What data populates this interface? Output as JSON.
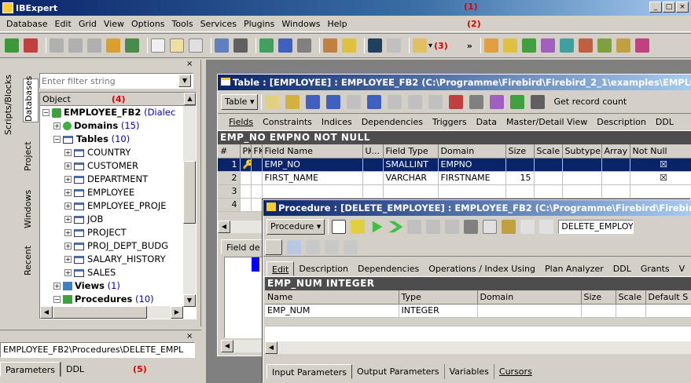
{
  "app": {
    "title": "IBExpert",
    "annotation1": "(1)",
    "annotation2": "(2)",
    "annotation3": "(3)",
    "annotation4": "(4)",
    "annotation5": "(5)"
  },
  "window_buttons": {
    "minimize": "_",
    "maximize": "□",
    "close": "×"
  },
  "menu": [
    "Database",
    "Edit",
    "Grid",
    "View",
    "Options",
    "Tools",
    "Services",
    "Plugins",
    "Windows",
    "Help"
  ],
  "toolbar": {
    "overflow": "»",
    "dropdown": "▾"
  },
  "leftpanel": {
    "close": "×",
    "filter_placeholder": "Enter filter string",
    "vtabs": [
      "Scripts/Blocks",
      "Databases",
      "Project",
      "Windows",
      "Recent"
    ],
    "object_header": "Object",
    "db_name": "EMPLOYEE_FB2",
    "db_suffix": "(Dialec",
    "domains": "Domains",
    "domains_count": "(15)",
    "tables": "Tables",
    "tables_count": "(10)",
    "table_items": [
      "COUNTRY",
      "CUSTOMER",
      "DEPARTMENT",
      "EMPLOYEE",
      "EMPLOYEE_PROJE",
      "JOB",
      "PROJECT",
      "PROJ_DEPT_BUDG",
      "SALARY_HISTORY",
      "SALES"
    ],
    "views": "Views",
    "views_count": "(1)",
    "procedures": "Procedures",
    "procedures_count": "(10)"
  },
  "bottompanel": {
    "close": "×",
    "path": "EMPLOYEE_FB2\\Procedures\\DELETE_EMPL",
    "tabs": [
      "Parameters",
      "DDL"
    ]
  },
  "table_window": {
    "title": "Table : [EMPLOYEE] : EMPLOYEE_FB2 (C:\\Programme\\Firebird\\Firebird_2_1\\examples\\EMPLOY",
    "menu_button": "Table ▾",
    "get_record_count": "Get record count",
    "tabs": [
      "Fields",
      "Constraints",
      "Indices",
      "Dependencies",
      "Triggers",
      "Data",
      "Master/Detail View",
      "Description",
      "DDL"
    ],
    "header_bar": "EMP_NO EMPNO NOT NULL",
    "columns": [
      "#",
      "PK",
      "FK",
      "Field Name",
      "U...",
      "Field Type",
      "Domain",
      "Size",
      "Scale",
      "Subtype",
      "Array",
      "Not Null"
    ],
    "rows": [
      {
        "num": "1",
        "pk": "🔑1",
        "fk": "",
        "name": "EMP_NO",
        "u": "",
        "type": "SMALLINT",
        "domain": "EMPNO",
        "size": "",
        "scale": "",
        "subtype": "",
        "array": "",
        "notnull": "☒"
      },
      {
        "num": "2",
        "pk": "",
        "fk": "",
        "name": "FIRST_NAME",
        "u": "",
        "type": "VARCHAR",
        "domain": "FIRSTNAME",
        "size": "15",
        "scale": "",
        "subtype": "",
        "array": "",
        "notnull": "☒"
      },
      {
        "num": "3",
        "pk": "",
        "fk": "",
        "name": "",
        "u": "",
        "type": "",
        "domain": "",
        "size": "",
        "scale": "",
        "subtype": "",
        "array": "",
        "notnull": ""
      },
      {
        "num": "4",
        "pk": "",
        "fk": "",
        "name": "",
        "u": "",
        "type": "",
        "domain": "",
        "size": "",
        "scale": "",
        "subtype": "",
        "array": "",
        "notnull": ""
      }
    ],
    "field_desc_tab": "Field de"
  },
  "procedure_window": {
    "title": "Procedure : [DELETE_EMPLOYEE] : EMPLOYEE_FB2 (C:\\Programme\\Firebird\\Firebird_2",
    "menu_button": "Procedure ▾",
    "name_field": "DELETE_EMPLOY",
    "tabs": [
      "Edit",
      "Description",
      "Dependencies",
      "Operations / Index Using",
      "Plan Analyzer",
      "DDL",
      "Grants",
      "V"
    ],
    "header_bar": "EMP_NUM INTEGER",
    "columns": [
      "Name",
      "Type",
      "Domain",
      "Size",
      "Scale",
      "Default S"
    ],
    "rows": [
      {
        "name": "EMP_NUM",
        "type": "INTEGER",
        "domain": "",
        "size": "",
        "scale": "",
        "default": ""
      }
    ],
    "bottom_tabs": [
      "Input Parameters",
      "Output Parameters",
      "Variables",
      "Cursors"
    ]
  },
  "colors": {
    "accent": "#0a246a",
    "annotation": "#e00000",
    "header_bar": "#4d4d4d"
  }
}
